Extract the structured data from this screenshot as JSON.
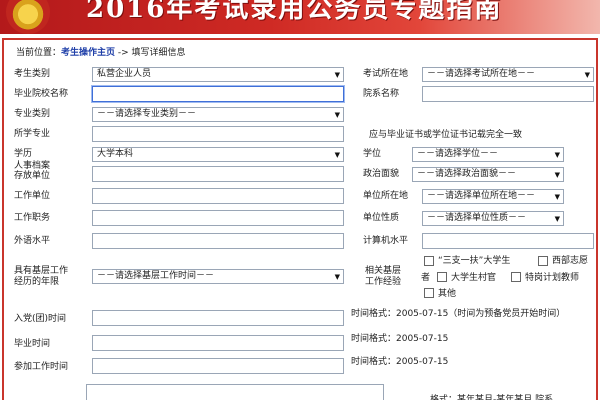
{
  "banner": {
    "title": "2016年考试录用公务员专题指南"
  },
  "breadcrumb": {
    "prefix": "当前位置：",
    "link": "考生操作主页",
    "separator": " -> ",
    "current": "填写详细信息"
  },
  "form": {
    "candidate_type": {
      "label": "考生类别",
      "value": "私营企业人员"
    },
    "exam_location": {
      "label": "考试所在地",
      "value": "－－请选择考试所在地－－"
    },
    "school_name": {
      "label": "毕业院校名称",
      "value": ""
    },
    "department_name": {
      "label": "院系名称",
      "value": ""
    },
    "major_category": {
      "label": "专业类别",
      "value": "－－请选择专业类别－－"
    },
    "major": {
      "label": "所学专业",
      "value": ""
    },
    "diploma_note": "应与毕业证书或学位证书记载完全一致",
    "education": {
      "label": "学历",
      "value": "大学本科"
    },
    "degree": {
      "label": "学位",
      "value": "－－请选择学位－－"
    },
    "archive_unit": {
      "label_line1": "人事档案",
      "label_line2": "存放单位",
      "value": ""
    },
    "political_status": {
      "label": "政治面貌",
      "value": "－－请选择政治面貌－－"
    },
    "work_unit": {
      "label": "工作单位",
      "value": ""
    },
    "unit_location": {
      "label": "单位所在地",
      "value": "－－请选择单位所在地－－"
    },
    "job_title": {
      "label": "工作职务",
      "value": ""
    },
    "unit_nature": {
      "label": "单位性质",
      "value": "－－请选择单位性质－－"
    },
    "foreign_language": {
      "label": "外语水平",
      "value": ""
    },
    "computer_level": {
      "label": "计算机水平",
      "value": ""
    },
    "grassroots_years": {
      "label_line1": "具有基层工作",
      "label_line2": "经历的年限",
      "value": "－－请选择基层工作时间－－"
    },
    "grassroots_exp": {
      "label_line1": "相关基层",
      "label_line2": "工作经验",
      "options": [
        "“三支一扶”大学生",
        "西部志愿",
        "者",
        "大学生村官",
        "特岗计划教师",
        "其他"
      ]
    },
    "party_date": {
      "label": "入党(团)时间",
      "format": "时间格式：2005-07-15（时间为预备党员开始时间）"
    },
    "graduation_date": {
      "label": "毕业时间",
      "format": "时间格式：2005-07-15"
    },
    "work_start_date": {
      "label": "参加工作时间",
      "format": "时间格式：2005-07-15"
    },
    "bottom_format": "格式：某年某月-某年某月 院系"
  }
}
